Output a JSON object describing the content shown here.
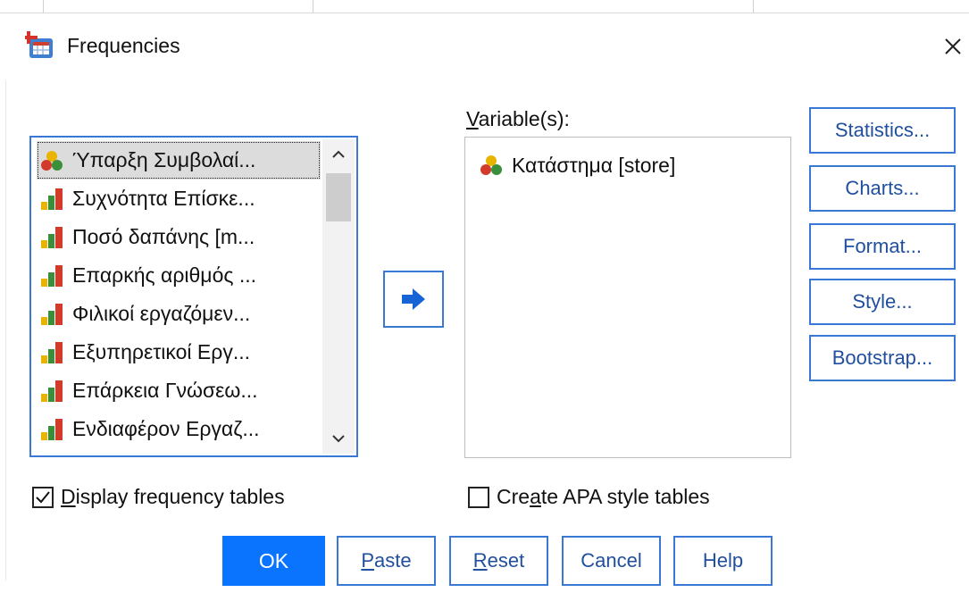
{
  "window": {
    "title": "Frequencies"
  },
  "source_list": {
    "items": [
      {
        "label": "Ύπαρξη Συμβολαί...",
        "icon": "nominal-variable-icon",
        "selected": true
      },
      {
        "label": "Συχνότητα Επίσκε...",
        "icon": "scale-variable-icon"
      },
      {
        "label": "Ποσό δαπάνης [m...",
        "icon": "scale-variable-icon"
      },
      {
        "label": "Επαρκής αριθμός ...",
        "icon": "scale-variable-icon"
      },
      {
        "label": "Φιλικοί εργαζόμεν...",
        "icon": "scale-variable-icon"
      },
      {
        "label": "Εξυπηρετικοί Εργ...",
        "icon": "scale-variable-icon"
      },
      {
        "label": "Επάρκεια Γνώσεω...",
        "icon": "scale-variable-icon"
      },
      {
        "label": "Ενδιαφέρον Εργαζ...",
        "icon": "scale-variable-icon"
      }
    ]
  },
  "target": {
    "label_mnemonic": "V",
    "label_rest": "ariable(s):",
    "items": [
      {
        "label": "Κατάστημα [store]",
        "icon": "nominal-variable-icon"
      }
    ]
  },
  "side_buttons": {
    "statistics": {
      "m": "S",
      "rest": "tatistics..."
    },
    "charts": {
      "m": "C",
      "rest": "harts..."
    },
    "format": {
      "m": "F",
      "rest": "ormat..."
    },
    "style_pre": "Sty",
    "style_m": "l",
    "style_post": "e...",
    "bootstrap": {
      "m": "B",
      "rest": "ootstrap..."
    }
  },
  "options": {
    "display_freq": {
      "m": "D",
      "rest": "isplay frequency tables",
      "checked": true
    },
    "apa": {
      "pre": "Cre",
      "m": "a",
      "post": "te APA style tables",
      "checked": false
    }
  },
  "buttons": {
    "ok": "OK",
    "paste": {
      "m": "P",
      "rest": "aste"
    },
    "reset": {
      "m": "R",
      "rest": "eset"
    },
    "cancel": "Cancel",
    "help": "Help"
  },
  "colors": {
    "accent": "#3a78d6",
    "primary": "#0a74ff"
  }
}
